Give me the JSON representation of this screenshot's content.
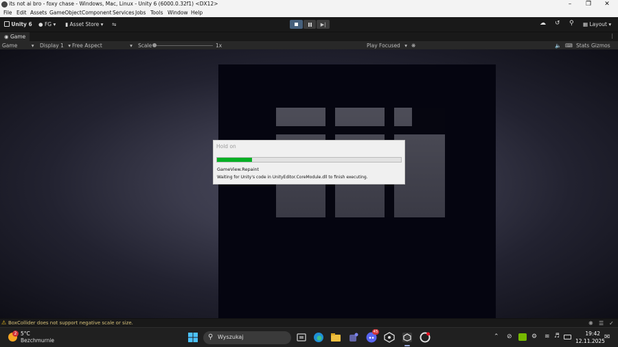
{
  "window": {
    "title": "its not ai bro - foxy chase - Windows, Mac, Linux - Unity 6 (6000.0.32f1) <DX12>",
    "controls": [
      "minimize-icon",
      "restore-icon",
      "close-icon"
    ]
  },
  "menu": [
    "File",
    "Edit",
    "Assets",
    "GameObject",
    "Component",
    "Services",
    "Jobs",
    "Tools",
    "Window",
    "Help"
  ],
  "toolbar": {
    "unity_label": "Unity 6",
    "account_label": "FG",
    "asset_store_label": "Asset Store",
    "layout_label": "Layout"
  },
  "tab": {
    "label": "Game"
  },
  "gamebar": {
    "mode": "Game",
    "display": "Display 1",
    "aspect": "Free Aspect",
    "scale_label": "Scale",
    "scale_value": "1x",
    "play_focused": "Play Focused",
    "stats": "Stats",
    "gizmos": "Gizmos"
  },
  "dialog": {
    "title": "Hold on",
    "progress": 0.19,
    "operation": "GameView.Repaint",
    "message": "Waiting for Unity's code in UnityEditor.CoreModule.dll to finish executing."
  },
  "status": {
    "warning": "BoxCollider does not support negative scale or size."
  },
  "taskbar": {
    "weather_badge": "2",
    "temperature": "5°C",
    "weather_desc": "Bezchmurnie",
    "search_placeholder": "Wyszukaj",
    "discord_badge": "45",
    "time": "19:42",
    "date": "12.11.2025"
  },
  "colors": {
    "progress_fill": "#06b025",
    "play_active": "#46607c",
    "warning": "#f0c020",
    "taskbar": "#202020"
  }
}
